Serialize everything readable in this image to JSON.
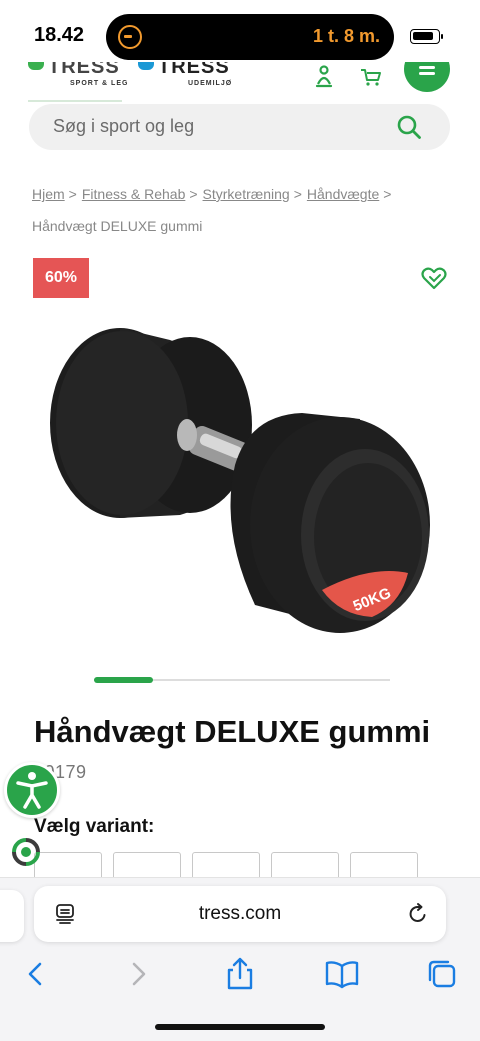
{
  "status_bar": {
    "time": "18.42",
    "island_text": "1 t. 8 m.",
    "battery_level": 0.85
  },
  "header": {
    "logo_left": {
      "main": "TRESS",
      "sub": "SPORT & LEG"
    },
    "logo_right": {
      "main": "TRESS",
      "sub": "UDEMILJØ"
    },
    "icons": [
      "user-icon",
      "cart-icon",
      "menu-icon"
    ]
  },
  "search": {
    "placeholder": "Søg i sport og leg",
    "icon": "search-icon"
  },
  "breadcrumb": {
    "items": [
      "Hjem",
      "Fitness & Rehab",
      "Styrketræning",
      "Håndvægte"
    ],
    "separator": ">",
    "current": "Håndvægt DELUXE gummi"
  },
  "badge": {
    "text": "60%",
    "color": "#e55555"
  },
  "product": {
    "image_label": "50KG",
    "title": "Håndvægt DELUXE gummi",
    "sku": "80179",
    "variant_label": "Vælg variant:",
    "carousel_position": 0.2
  },
  "browser": {
    "url": "tress.com",
    "toolbar": [
      "back-icon",
      "forward-icon",
      "share-icon",
      "bookmarks-icon",
      "tabs-icon"
    ]
  },
  "colors": {
    "accent": "#2aa44a",
    "badge": "#e55555",
    "blue": "#1a98d5",
    "link_blue": "#1a7de2"
  }
}
